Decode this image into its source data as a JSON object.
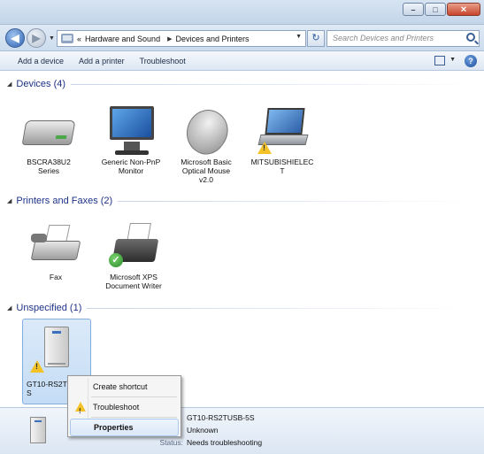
{
  "address": {
    "crumbs": [
      "Hardware and Sound",
      "Devices and Printers"
    ],
    "prefix": "«"
  },
  "search": {
    "placeholder": "Search Devices and Printers"
  },
  "toolbar": {
    "add_device": "Add a device",
    "add_printer": "Add a printer",
    "troubleshoot": "Troubleshoot"
  },
  "groups": {
    "devices": "Devices (4)",
    "printers": "Printers and Faxes (2)",
    "unspecified": "Unspecified (1)"
  },
  "devices": [
    {
      "label": "BSCRA38U2\nSeries",
      "icon": "external-drive-icon"
    },
    {
      "label": "Generic Non-PnP\nMonitor",
      "icon": "monitor-icon"
    },
    {
      "label": "Microsoft Basic\nOptical Mouse\nv2.0",
      "icon": "mouse-icon"
    },
    {
      "label": "MITSUBISHIELEC\nT",
      "icon": "laptop-icon"
    }
  ],
  "printers": [
    {
      "label": "Fax",
      "icon": "fax-icon"
    },
    {
      "label": "Microsoft XPS\nDocument Writer",
      "icon": "printer-icon"
    }
  ],
  "unspecified": [
    {
      "label": "GT10-RS2TU\nS",
      "icon": "tower-device-icon"
    }
  ],
  "context_menu": {
    "create_shortcut": "Create shortcut",
    "troubleshoot": "Troubleshoot",
    "properties": "Properties"
  },
  "details": {
    "rows": [
      {
        "k": "",
        "v": "GT10-RS2TUSB-5S"
      },
      {
        "k": "",
        "v": "Unknown"
      },
      {
        "k": "Status:",
        "v": "Needs troubleshooting"
      }
    ]
  },
  "colors": {
    "group_title": "#1e3287",
    "warning": "#f2c227",
    "default_check": "#2a8a2a"
  }
}
